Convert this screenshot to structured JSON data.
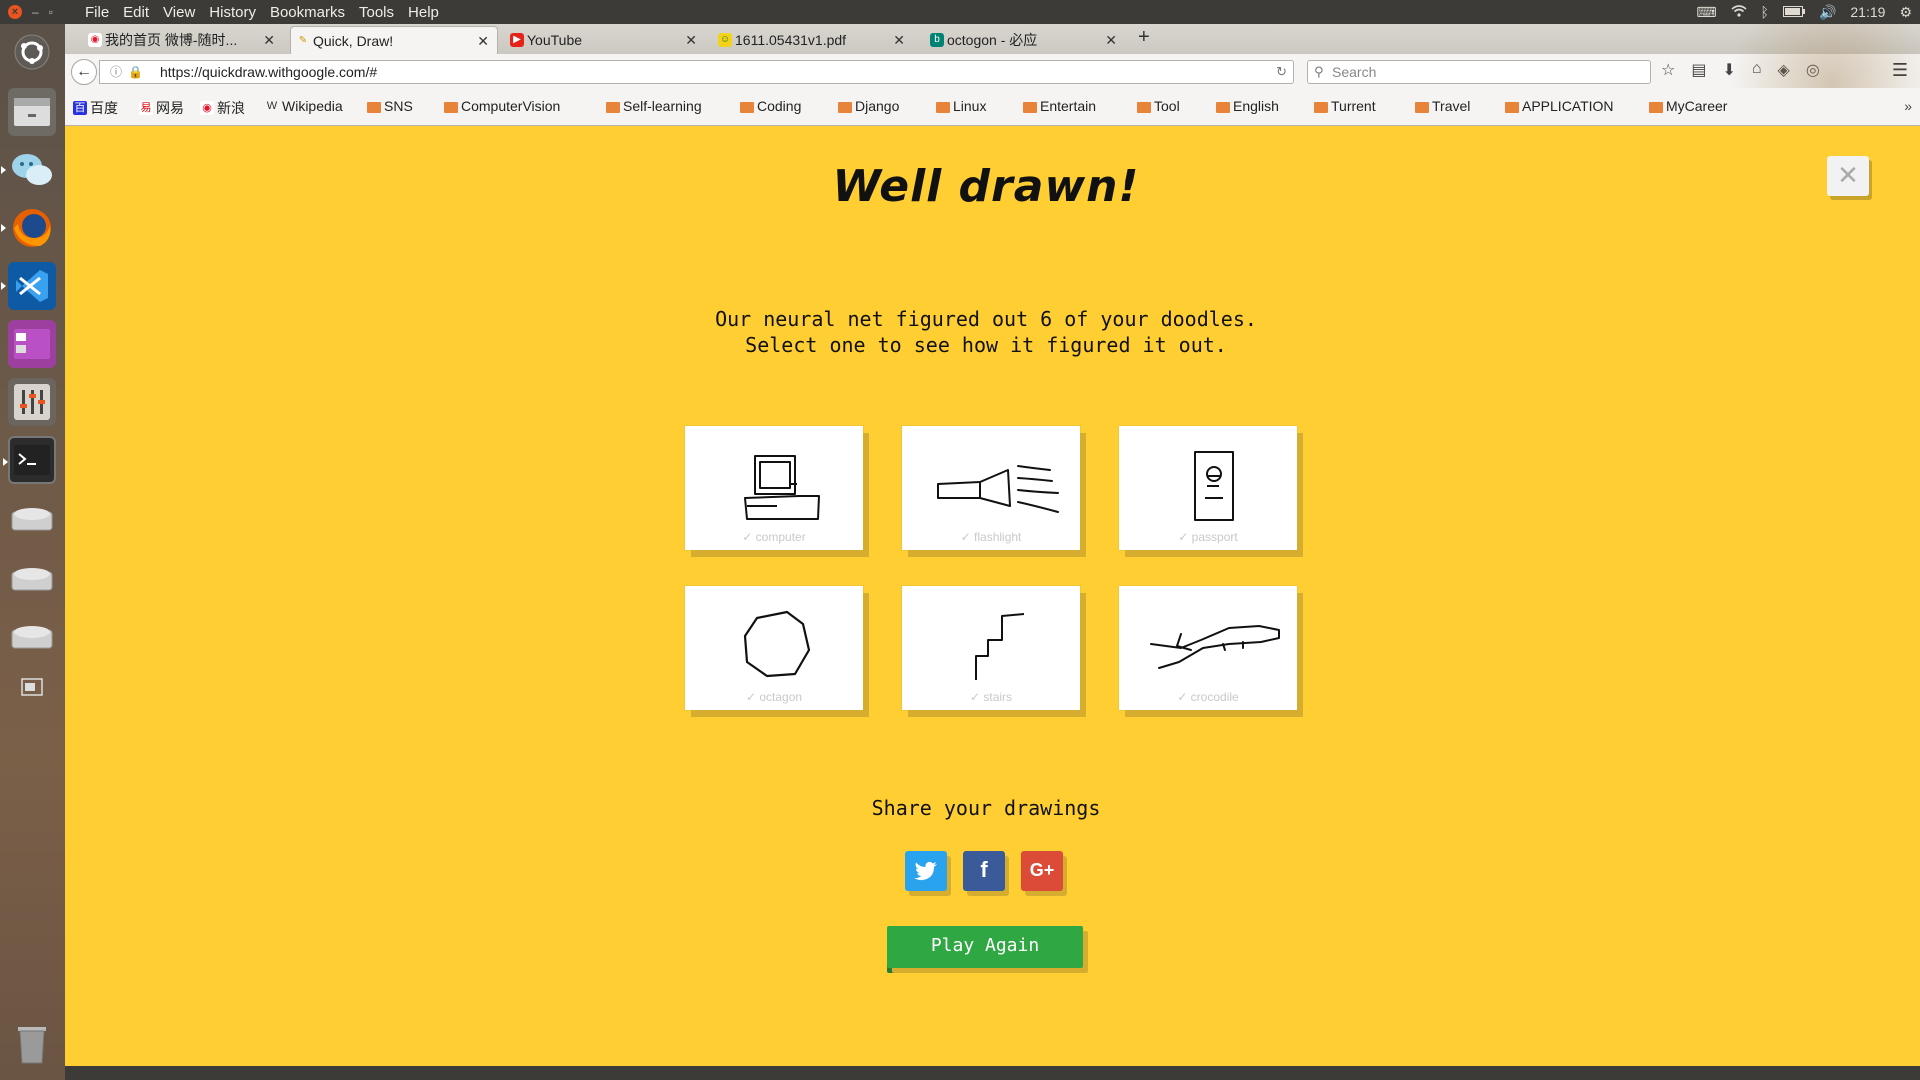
{
  "topbar": {
    "menus": [
      "File",
      "Edit",
      "View",
      "History",
      "Bookmarks",
      "Tools",
      "Help"
    ],
    "time": "21:19"
  },
  "tabs": [
    {
      "title": "我的首页 微博-随时..."
    },
    {
      "title": "Quick, Draw!"
    },
    {
      "title": "YouTube"
    },
    {
      "title": "1611.05431v1.pdf"
    },
    {
      "title": "octogon - 必应"
    }
  ],
  "navbar": {
    "url": "https://quickdraw.withgoogle.com/#",
    "search_placeholder": "Search"
  },
  "bookmarks": [
    "百度",
    "网易",
    "新浪",
    "Wikipedia",
    "SNS",
    "ComputerVision",
    "Self-learning",
    "Coding",
    "Django",
    "Linux",
    "Entertain",
    "Tool",
    "English",
    "Turrent",
    "Travel",
    "APPLICATION",
    "MyCareer"
  ],
  "page": {
    "title": "Well drawn!",
    "desc_line1": "Our neural net figured out 6 of your doodles.",
    "desc_line2": "Select one to see how it figured it out.",
    "close": "✕",
    "doodles": [
      {
        "label": "✓ computer"
      },
      {
        "label": "✓ flashlight"
      },
      {
        "label": "✓ passport"
      },
      {
        "label": "✓ octagon"
      },
      {
        "label": "✓ stairs"
      },
      {
        "label": "✓ crocodile"
      }
    ],
    "share_title": "Share your drawings",
    "share": {
      "twitter": "t",
      "facebook": "f",
      "google": "G+"
    },
    "play_again": "Play Again"
  },
  "colors": {
    "page_bg": "#ffce33",
    "play_button": "#2fa844",
    "twitter": "#2aa3ef",
    "facebook": "#3b5a9a",
    "google": "#dc4a38"
  }
}
